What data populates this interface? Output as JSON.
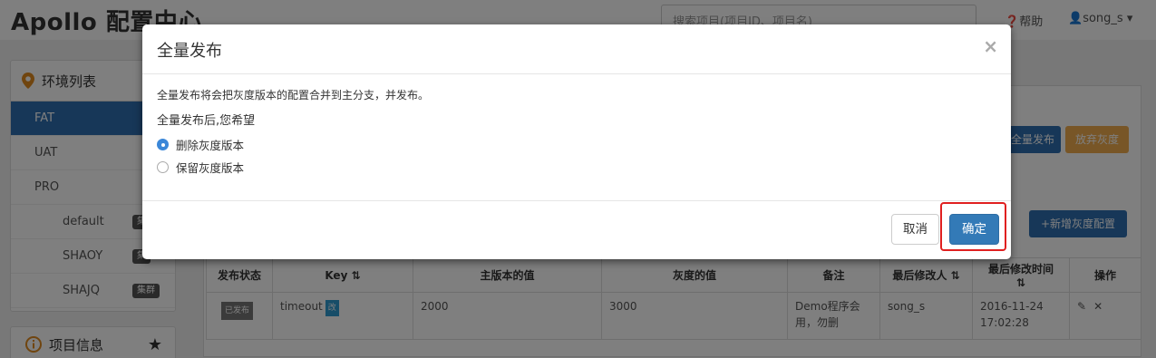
{
  "topbar": {
    "brand": "Apollo 配置中心",
    "search_placeholder": "搜索项目(项目ID、项目名)",
    "help": "帮助",
    "user": "song_s"
  },
  "sidebar": {
    "title": "环境列表",
    "envs": [
      {
        "label": "FAT"
      },
      {
        "label": "UAT"
      },
      {
        "label": "PRO"
      }
    ],
    "clusters": [
      {
        "label": "default",
        "badge": "集"
      },
      {
        "label": "SHAOY",
        "badge": "集"
      },
      {
        "label": "SHAJQ",
        "badge": "集群"
      }
    ],
    "info_title": "项目信息"
  },
  "main": {
    "full_publish_label": "全量发布",
    "abandon_gray_label": "放弃灰度",
    "new_gray_config_label": "新增灰度配置",
    "table": {
      "headers": [
        "发布状态",
        "Key",
        "主版本的值",
        "灰度的值",
        "备注",
        "最后修改人",
        "最后修改时间",
        "操作"
      ],
      "rows": [
        {
          "status": "已发布",
          "key": "timeout",
          "key_tag": "改",
          "main_value": "2000",
          "gray_value": "3000",
          "comment": "Demo程序会用，勿删",
          "modifier": "song_s",
          "modified_time": "2016-11-24 17:02:28"
        }
      ]
    }
  },
  "modal": {
    "title": "全量发布",
    "close": "×",
    "description": "全量发布将会把灰度版本的配置合并到主分支，并发布。",
    "question": "全量发布后,您希望",
    "options": [
      {
        "label": "删除灰度版本",
        "selected": true
      },
      {
        "label": "保留灰度版本",
        "selected": false
      }
    ],
    "cancel_label": "取消",
    "confirm_label": "确定"
  },
  "colors": {
    "primary": "#337ab7",
    "warning": "#f0ad4e",
    "highlight": "#e02020"
  }
}
